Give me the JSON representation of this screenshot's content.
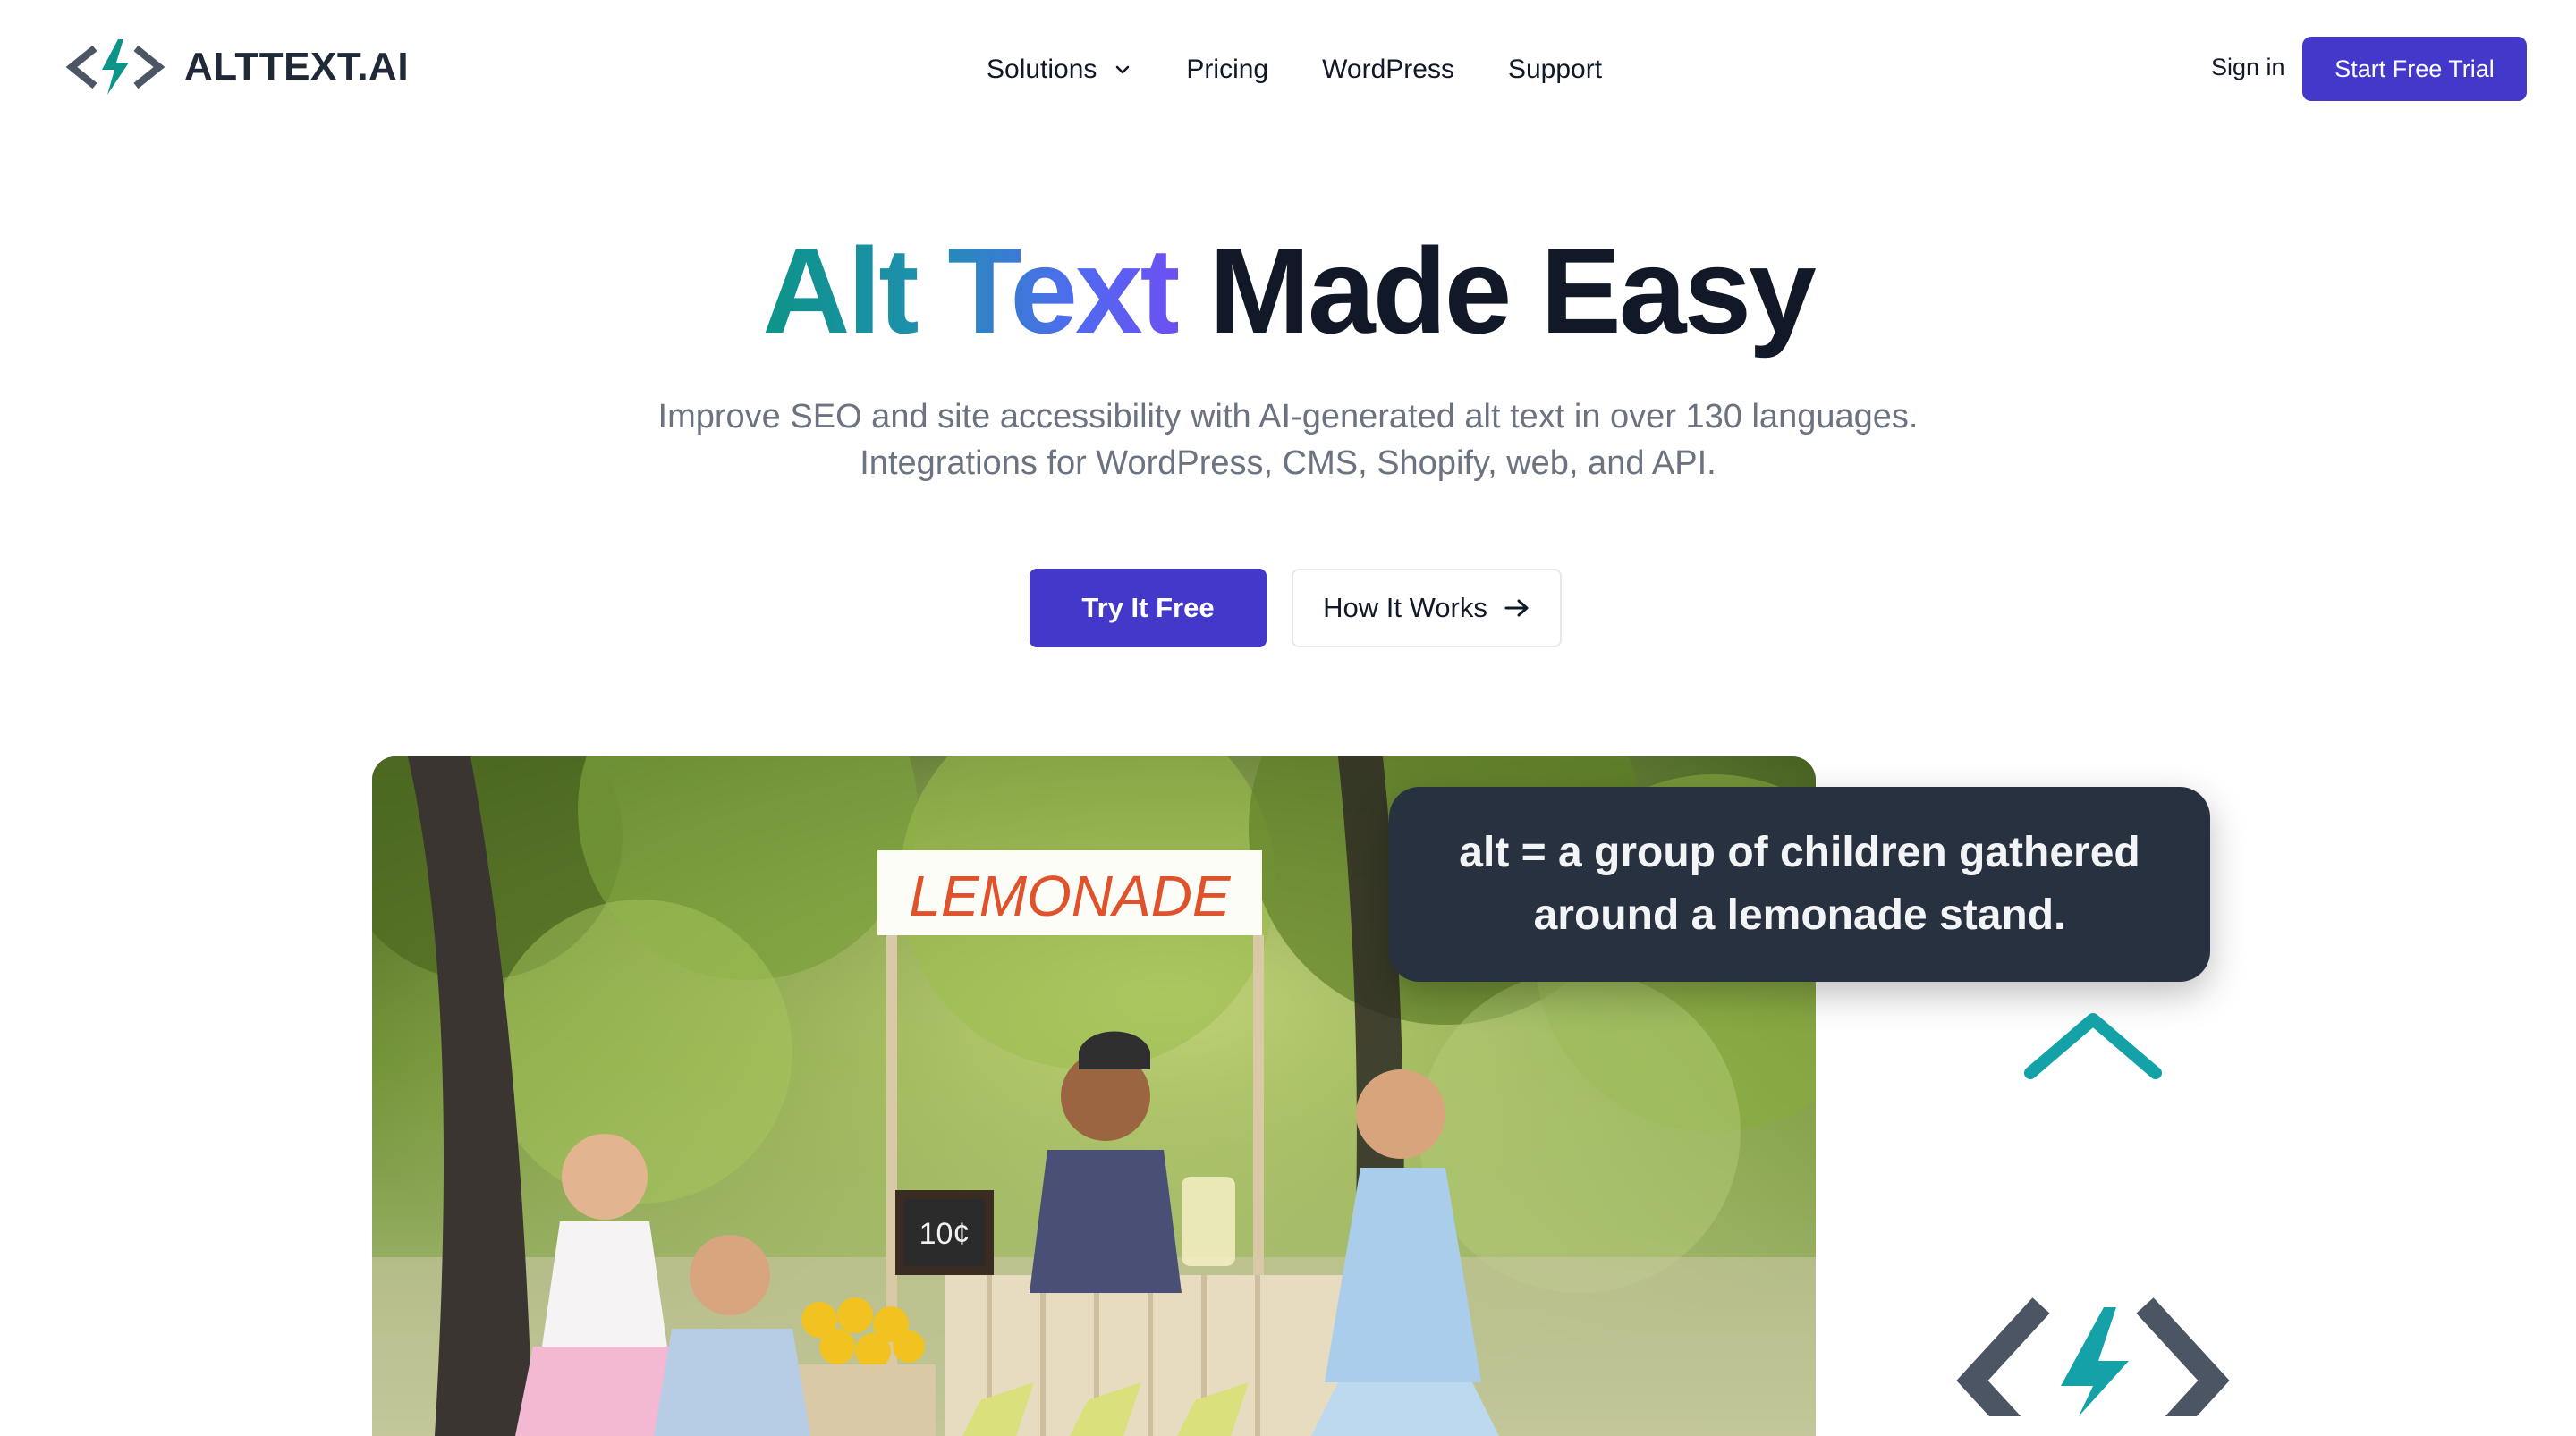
{
  "brand": {
    "name": "ALTTEXT.AI",
    "colors": {
      "teal": "#0d9488",
      "indigo": "#4338ca",
      "dark": "#111827",
      "slate": "#4b5563"
    }
  },
  "nav": {
    "items": [
      {
        "label": "Solutions",
        "icon": "chevron-down-icon"
      },
      {
        "label": "Pricing"
      },
      {
        "label": "WordPress"
      },
      {
        "label": "Support"
      }
    ],
    "sign_in": "Sign in",
    "cta": "Start Free Trial"
  },
  "hero": {
    "title_highlight": "Alt Text",
    "title_rest": "Made Easy",
    "subtitle_line1": "Improve SEO and site accessibility with AI-generated alt text in over 130 languages.",
    "subtitle_line2": "Integrations for WordPress, CMS, Shopify, web, and API.",
    "primary_button": "Try It Free",
    "secondary_button": "How It Works",
    "secondary_icon": "arrow-right-icon"
  },
  "demo": {
    "sign_text": "LEMONADE",
    "price_text": "10¢",
    "alt_line1": "alt = a group of children gathered",
    "alt_line2": "around a lemonade stand."
  }
}
